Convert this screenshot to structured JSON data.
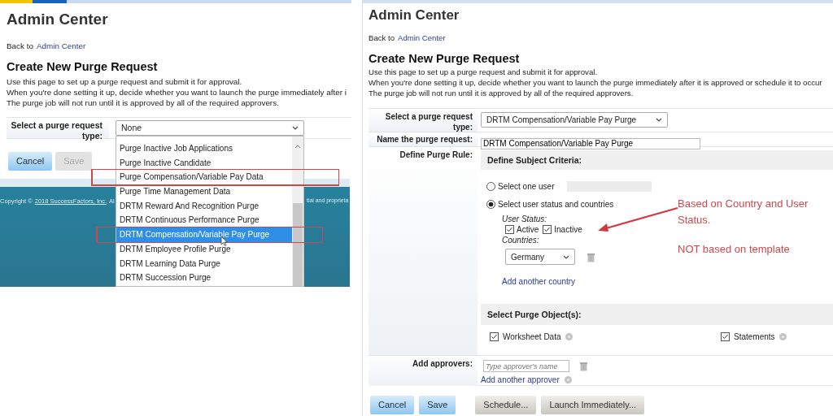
{
  "left_screen": {
    "title": "Admin Center",
    "back_prefix": "Back to",
    "back_link": "Admin Center",
    "heading": "Create New Purge Request",
    "description": [
      "Use this page to set up a purge request and submit it for approval.",
      "When you're done setting it up, decide whether you want to launch the purge immediately after i",
      "The purge job will not run until it is approved by all of the required approvers."
    ],
    "request_type": {
      "label": "Select a purge request type:",
      "value": "None"
    },
    "dropdown": [
      {
        "label": "Purge Inactive Job Applications",
        "selected": false,
        "annotated": false
      },
      {
        "label": "Purge Inactive Candidate",
        "selected": false,
        "annotated": false
      },
      {
        "label": "Purge Compensation/Variable Pay Data",
        "selected": false,
        "annotated": true
      },
      {
        "label": "Purge Time Management Data",
        "selected": false,
        "annotated": false
      },
      {
        "label": "DRTM Reward And Recognition Purge",
        "selected": false,
        "annotated": false
      },
      {
        "label": "DRTM Continuous Performance Purge",
        "selected": false,
        "annotated": false
      },
      {
        "label": "DRTM Compensation/Variable Pay Purge",
        "selected": true,
        "annotated": true
      },
      {
        "label": "DRTM Employee Profile Purge",
        "selected": false,
        "annotated": false
      },
      {
        "label": "DRTM Learning Data Purge",
        "selected": false,
        "annotated": false
      },
      {
        "label": "DRTM Succession Purge",
        "selected": false,
        "annotated": false
      }
    ],
    "buttons": [
      {
        "label": "Cancel",
        "disabled": false
      },
      {
        "label": "Save",
        "disabled": true
      }
    ],
    "footer": {
      "prefix": "Copyright ©",
      "link": "2018 SuccessFactors, Inc.",
      "suffix": "Al",
      "right_fragment": "tial and proprieta"
    }
  },
  "right_screen": {
    "title": "Admin Center",
    "back_prefix": "Back to",
    "back_link": "Admin Center",
    "heading": "Create New Purge Request",
    "description": [
      "Use this page to set up a purge request and submit it for approval.",
      "When you're done setting it up, decide whether you want to launch the purge immediately after it is approved or schedule it to occur",
      "The purge job will not run until it is approved by all of the required approvers."
    ],
    "request_type": {
      "label": "Select a purge request type:",
      "value": "DRTM Compensation/Variable Pay Purge"
    },
    "request_name": {
      "label": "Name the purge request:",
      "value": "DRTM Compensation/Variable Pay Purge"
    },
    "purge_rule": {
      "label": "Define Purge Rule:",
      "criteria_header": "Define Subject Criteria:",
      "options": [
        {
          "label": "Select one user",
          "selected": false
        },
        {
          "label": "Select user status and countries",
          "selected": true
        }
      ],
      "status_label": "User Status:",
      "statuses": [
        {
          "label": "Active",
          "checked": true
        },
        {
          "label": "Inactive",
          "checked": true
        }
      ],
      "countries_label": "Countries:",
      "country": "Germany",
      "add_country": "Add another country",
      "objects_header": "Select Purge Object(s):",
      "objects": [
        {
          "label": "Worksheet Data",
          "checked": true
        },
        {
          "label": "Statements",
          "checked": true
        }
      ]
    },
    "approvers": {
      "label": "Add approvers:",
      "placeholder": "Type approver's name",
      "add_link": "Add another approver"
    },
    "buttons": [
      {
        "label": "Cancel",
        "kind": "primary"
      },
      {
        "label": "Save",
        "kind": "primary"
      },
      {
        "label": "Schedule...",
        "kind": "secondary"
      },
      {
        "label": "Launch Immediately...",
        "kind": "secondary"
      }
    ],
    "annotation": {
      "text": "Based on Country and User Status.",
      "note": "NOT based on template"
    }
  }
}
